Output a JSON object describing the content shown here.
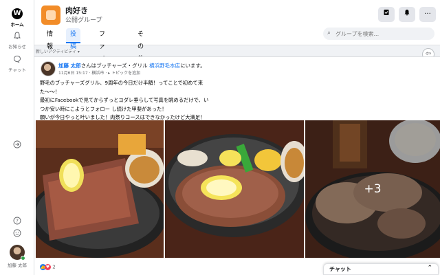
{
  "nav": {
    "home_label": "ホーム",
    "notifications_label": "お知らせ",
    "chat_label": "チャット",
    "user_name": "加藤 太郎"
  },
  "group": {
    "name": "肉好き",
    "type": "公開グループ"
  },
  "tabs": [
    {
      "label": "情報"
    },
    {
      "label": "投稿"
    },
    {
      "label": "ファイル"
    },
    {
      "label": "その他▾"
    }
  ],
  "search": {
    "placeholder": "グループを検索..."
  },
  "sort_label": "新しいアクティビティ ▾",
  "post": {
    "author": "加藤 太郎",
    "action_text": "さんはブッチャーズ・グリル ",
    "location": "横浜野毛本店",
    "action_suffix": "にいます。",
    "date": "11月6日 15:17",
    "city": "横浜市",
    "topic_link": "トピックを追加",
    "body_lines": [
      "野毛のブッチャーズグリル、9周年の今日だけ半額！ってことで初めて来",
      "た〜〜！",
      "最初にFacebookで見てからずっとヨダレ垂らして写真を眺めるだけで、い",
      "つか安い時にこようとフォロー し続けた甲斐があった！",
      "願いが今日やっと叶いました！肉祭りコースはできなかったけど大満足！"
    ],
    "more_photos": "+3",
    "reaction_count": "2"
  },
  "chat_panel": {
    "label": "チャット"
  }
}
